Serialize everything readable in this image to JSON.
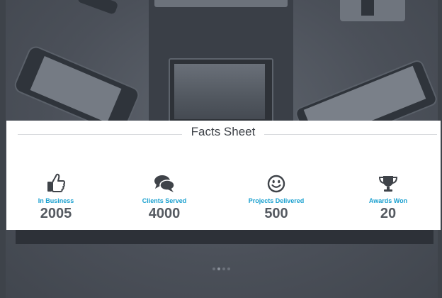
{
  "facts": {
    "title": "Facts Sheet",
    "items": [
      {
        "icon": "thumbs-up-icon",
        "label": "In Business",
        "value": "2005"
      },
      {
        "icon": "chat-bubbles-icon",
        "label": "Clients Served",
        "value": "4000"
      },
      {
        "icon": "smiley-icon",
        "label": "Projects Delivered",
        "value": "500"
      },
      {
        "icon": "trophy-icon",
        "label": "Awards Won",
        "value": "20"
      }
    ]
  },
  "colors": {
    "accent": "#1aa0cf",
    "value_text": "#555a61",
    "background": "#4a5059"
  },
  "slider": {
    "dots_count": 4,
    "active_index": 1
  }
}
